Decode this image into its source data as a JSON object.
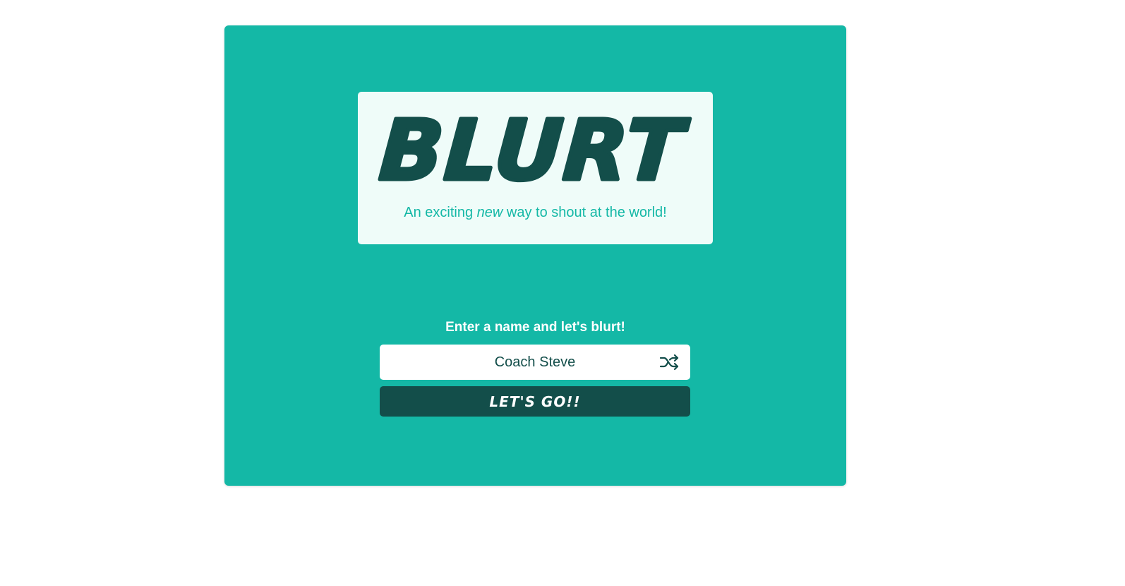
{
  "logo": {
    "word": "BLURT",
    "tagline_before": "An exciting ",
    "tagline_emphasis": "new",
    "tagline_after": " way to shout at the world!"
  },
  "form": {
    "prompt": "Enter a name and let's blurt!",
    "name_value": "Coach Steve",
    "shuffle_icon": "shuffle-icon",
    "submit_label": "LET'S GO!!"
  },
  "colors": {
    "card_bg": "#14b8a6",
    "logo_bg": "#effcf9",
    "dark_teal": "#134e4a",
    "white": "#ffffff"
  }
}
